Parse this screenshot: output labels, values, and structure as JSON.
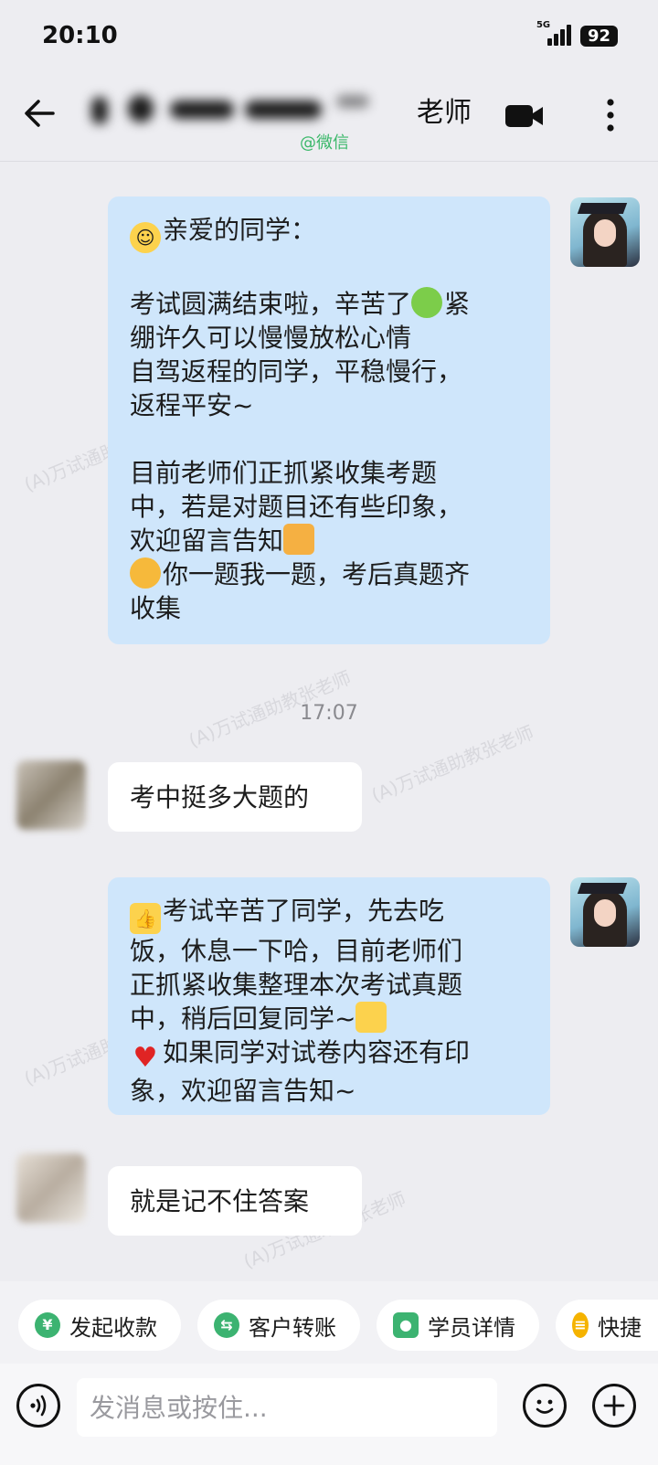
{
  "status_bar": {
    "time": "20:10",
    "network": "5G",
    "battery": "92"
  },
  "header": {
    "title_visible": "老师",
    "subtitle": "@微信",
    "icons": {
      "back": "back-arrow-icon",
      "video": "video-call-icon",
      "more": "more-vertical-icon"
    }
  },
  "messages": [
    {
      "sender": "teacher",
      "lines": [
        "亲爱的同学：",
        "",
        "考试圆满结束啦，辛苦了",
        "绷许久可以慢慢放松心情",
        "自驾返程的同学，平稳慢行，",
        "返程平安~",
        "",
        "目前老师们正抓紧收集考题",
        "中，若是对题目还有些印象，",
        "欢迎留言告知",
        "你一题我一题，考后真题齐",
        "收集"
      ],
      "inline_after_line_3": "紧"
    },
    {
      "sender": "timestamp",
      "text": "17:07"
    },
    {
      "sender": "student",
      "text": "考中挺多大题的"
    },
    {
      "sender": "teacher",
      "lines": [
        "考试辛苦了同学，先去吃",
        "饭，休息一下哈，目前老师们",
        "正抓紧收集整理本次考试真题",
        "中，稍后回复同学~",
        "如果同学对试卷内容还有印",
        "象，欢迎留言告知~"
      ]
    },
    {
      "sender": "student",
      "text": "就是记不住答案"
    }
  ],
  "quick_actions": [
    {
      "label": "发起收款",
      "icon": "yuan-icon",
      "color": "#3cb371"
    },
    {
      "label": "客户转账",
      "icon": "transfer-icon",
      "color": "#3cb371"
    },
    {
      "label": "学员详情",
      "icon": "user-icon",
      "color": "#3cb371"
    },
    {
      "label": "快捷",
      "icon": "shortcut-icon",
      "color": "#f5b300"
    }
  ],
  "input_bar": {
    "placeholder": "发消息或按住...",
    "icons": {
      "voice": "voice-icon",
      "emoji": "emoji-icon",
      "plus": "plus-icon"
    }
  },
  "watermark_text": "(A)万试通助教张老师"
}
